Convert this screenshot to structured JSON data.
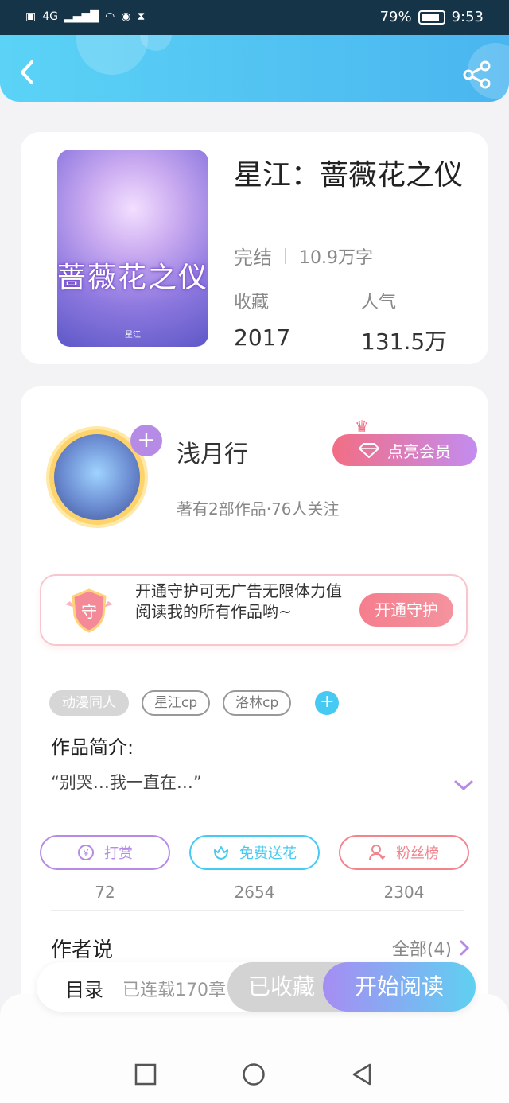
{
  "status_bar": {
    "network": "4G",
    "battery_percent": "79%",
    "time": "9:53"
  },
  "book": {
    "title": "星江：蔷薇花之仪",
    "cover_title": "蔷薇花之仪",
    "cover_subtitle": "星江",
    "status": "完结",
    "word_count": "10.9万字",
    "favorites_label": "收藏",
    "favorites_value": "2017",
    "popularity_label": "人气",
    "popularity_value": "131.5万"
  },
  "author": {
    "name": "浅月行",
    "meta": "著有2部作品·76人关注",
    "vip_label": "点亮会员"
  },
  "guard": {
    "badge": "守",
    "text": "开通守护可无广告无限体力值阅读我的所有作品哟~",
    "button": "开通守护"
  },
  "tags": [
    "动漫同人",
    "星江cp",
    "洛林cp"
  ],
  "intro": {
    "title": "作品简介:",
    "text": "“别哭…我一直在…”"
  },
  "actions": [
    {
      "label": "打赏",
      "count": "72",
      "icon": "yen-coin-icon",
      "color": "#b58be6"
    },
    {
      "label": "免费送花",
      "count": "2654",
      "icon": "flower-icon",
      "color": "#46c9f3"
    },
    {
      "label": "粉丝榜",
      "count": "2304",
      "icon": "fan-user-icon",
      "color": "#f2848e"
    }
  ],
  "author_says": {
    "title": "作者说",
    "all_label": "全部(4)"
  },
  "reader_bar": {
    "toc_label": "目录",
    "progress": "已连载170章",
    "collected": "已收藏",
    "read": "开始阅读"
  },
  "colors": {
    "header_start": "#5bd3f6",
    "header_end": "#4ab5ef",
    "accent_purple": "#b58be6",
    "accent_pink": "#f26e84"
  }
}
